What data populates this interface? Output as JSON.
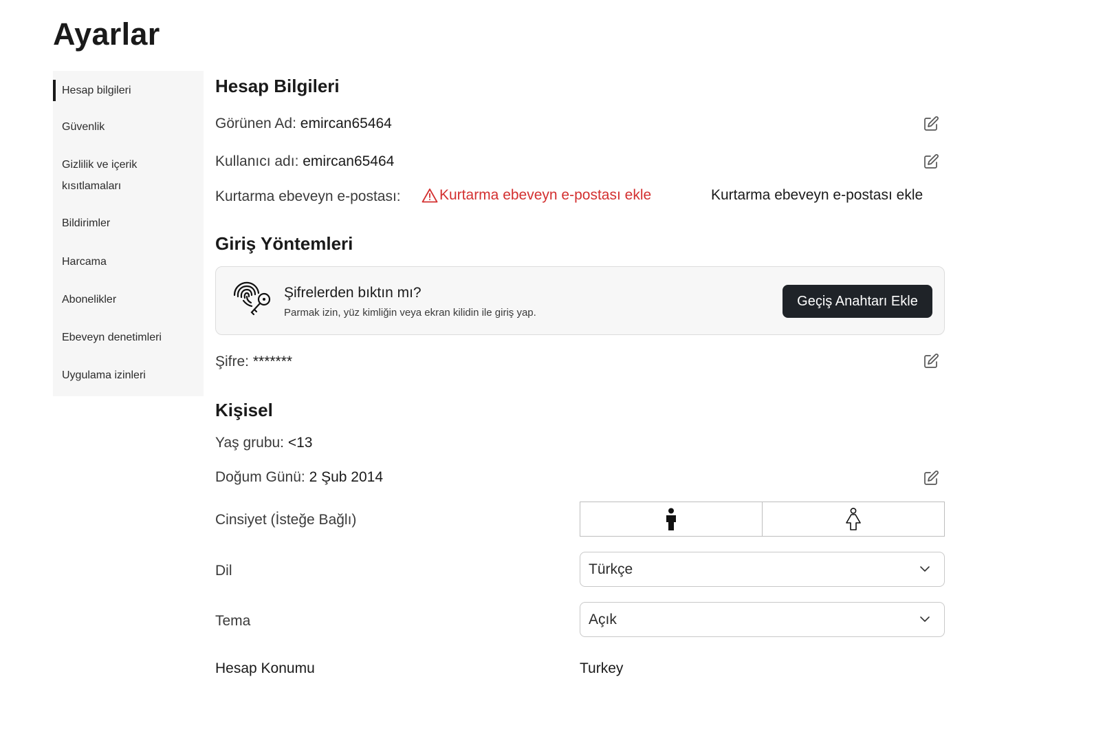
{
  "page": {
    "title": "Ayarlar"
  },
  "sidebar": {
    "items": [
      {
        "label": "Hesap bilgileri",
        "active": true
      },
      {
        "label": "Güvenlik"
      },
      {
        "label": "Gizlilik ve içerik",
        "label2": "kısıtlamaları"
      },
      {
        "label": "Bildirimler"
      },
      {
        "label": "Harcama"
      },
      {
        "label": "Abonelikler"
      },
      {
        "label": "Ebeveyn denetimleri"
      },
      {
        "label": "Uygulama izinleri"
      }
    ]
  },
  "account": {
    "title": "Hesap Bilgileri",
    "display_name_label": "Görünen Ad: ",
    "display_name_value": "emircan65464",
    "username_label": "Kullanıcı adı: ",
    "username_value": "emircan65464",
    "recovery_label": "Kurtarma ebeveyn e-postası:",
    "recovery_warning": "Kurtarma ebeveyn e-postası ekle",
    "recovery_action": "Kurtarma ebeveyn e-postası ekle"
  },
  "login": {
    "title": "Giriş Yöntemleri",
    "passkey_title": "Şifrelerden bıktın mı?",
    "passkey_sub": "Parmak izin, yüz kimliğin veya ekran kilidin ile giriş yap.",
    "passkey_button": "Geçiş Anahtarı Ekle",
    "password_label": "Şifre: ",
    "password_value": "*******"
  },
  "personal": {
    "title": "Kişisel",
    "age_label": "Yaş grubu: ",
    "age_value": "<13",
    "birthday_label": "Doğum Günü: ",
    "birthday_value": "2 Şub 2014",
    "gender_label": "Cinsiyet (İsteğe Bağlı)",
    "language_label": "Dil",
    "language_value": "Türkçe",
    "theme_label": "Tema",
    "theme_value": "Açık",
    "location_label": "Hesap Konumu",
    "location_value": "Turkey"
  },
  "colors": {
    "accent_dark": "#1f2328",
    "warning": "#d32f2f",
    "sidebar_bg": "#f6f6f6"
  },
  "icons": [
    "edit-icon",
    "warning-icon",
    "fingerprint-key-icon",
    "male-icon",
    "female-icon",
    "chevron-down-icon"
  ]
}
